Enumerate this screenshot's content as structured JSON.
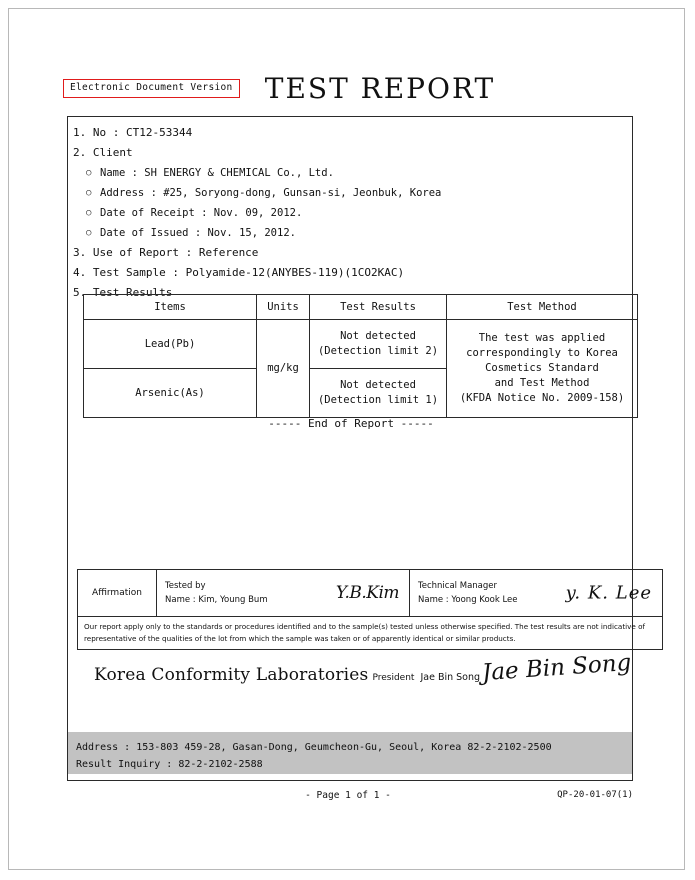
{
  "header": {
    "stamp": "Electronic Document Version",
    "title": "TEST  REPORT",
    "stamp_border_color": "#e01b1b"
  },
  "report": {
    "no_label": "1. No : ",
    "no_value": "CT12-53344",
    "client_label": "2. Client",
    "client": {
      "name": "Name : SH ENERGY & CHEMICAL Co., Ltd.",
      "address": "Address : #25, Soryong-dong, Gunsan-si, Jeonbuk, Korea",
      "date_of_receipt": "Date of Receipt : Nov. 09, 2012.",
      "date_of_issued": "Date of Issued : Nov. 15, 2012."
    },
    "use_of_report": "3. Use of Report : Reference",
    "test_sample": "4. Test Sample : Polyamide-12(ANYBES-119)(1CO2KAC)",
    "test_results_label": "5. Test Results",
    "bullet_glyph": "○"
  },
  "results_table": {
    "headers": [
      "Items",
      "Units",
      "Test Results",
      "Test Method"
    ],
    "rows": [
      {
        "item": "Lead(Pb)",
        "result_line1": "Not detected",
        "result_line2": "(Detection limit 2)"
      },
      {
        "item": "Arsenic(As)",
        "result_line1": "Not detected",
        "result_line2": "(Detection limit 1)"
      }
    ],
    "units": "mg/kg",
    "method_lines": [
      "The test was applied",
      "correspondingly to Korea",
      "Cosmetics Standard",
      "and Test Method",
      "(KFDA Notice No. 2009-158)"
    ]
  },
  "end_of_report": "----- End of Report -----",
  "affirmation": {
    "label": "Affirmation",
    "tested_by": {
      "role": "Tested by",
      "name": "Name : Kim, Young Bum",
      "signature": "Y.B.Kim"
    },
    "technical_manager": {
      "role": "Technical Manager",
      "name": "Name : Yoong Kook Lee",
      "signature": "y. K. Lee"
    },
    "disclaimer": "Our report apply only to the standards or procedures identified and to the sample(s) tested unless otherwise specified. The test results are not indicative of representative of the qualities of the lot from which the sample was taken or of apparently identical or similar products."
  },
  "lab": {
    "name": "Korea Conformity Laboratories",
    "role": "President",
    "person": "Jae Bin Song",
    "signature": "Jae Bin Song"
  },
  "address_band": {
    "line1": "Address : 153-803  459-28, Gasan-Dong, Geumcheon-Gu, Seoul, Korea   82-2-2102-2500",
    "line2": "Result Inquiry :    82-2-2102-2588",
    "background": "#c2c2c2"
  },
  "footer": {
    "page": "- Page 1 of 1 -",
    "form_code": "QP-20-01-07(1)"
  }
}
